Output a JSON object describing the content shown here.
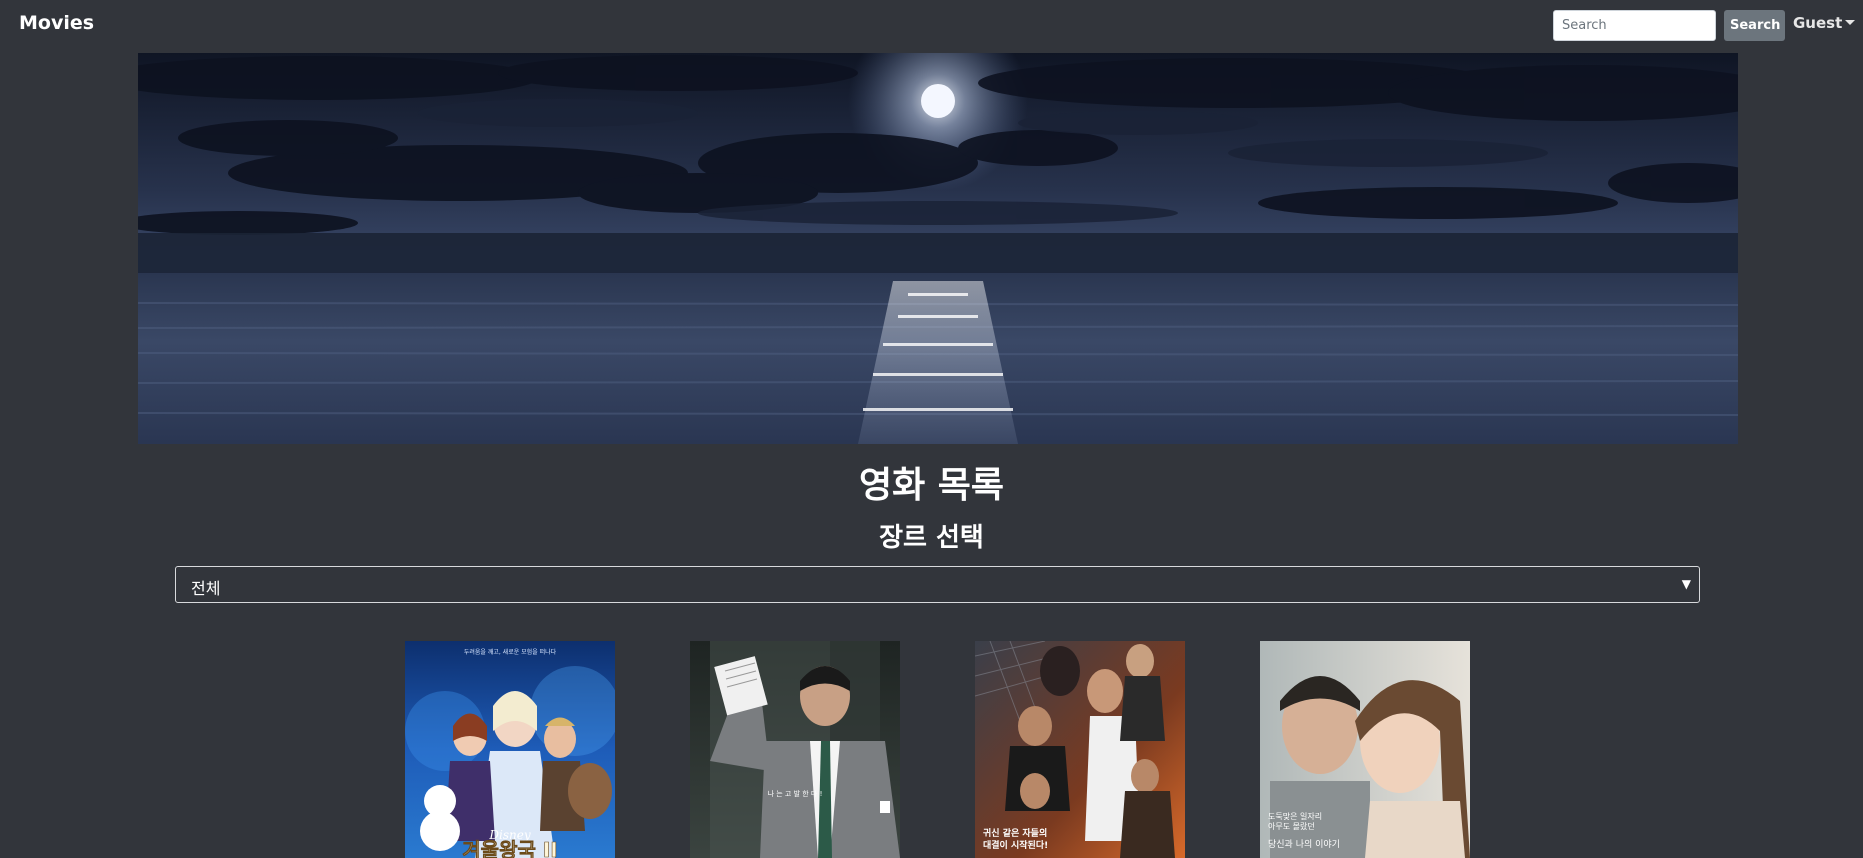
{
  "navbar": {
    "brand": "Movies",
    "search_placeholder": "Search",
    "search_button": "Search",
    "user_label": "Guest"
  },
  "main": {
    "title": "영화 목록",
    "genre_heading": "장르 선택",
    "genre_select": {
      "selected": "전체"
    },
    "movies": [
      {
        "poster_top_text": "두려움을 깨고, 새로운 모험을 떠나다",
        "poster_brand": "Disney",
        "poster_title": "겨울왕국 II"
      },
      {
        "poster_mid_text": "나 는 고 발 한 다 !"
      },
      {
        "poster_tagline_1": "귀신 같은 자들의",
        "poster_tagline_2": "대결이 시작된다!"
      },
      {
        "poster_tagline_1": "도둑맞은 일자리",
        "poster_tagline_2": "아무도 몰랐던",
        "poster_tagline_3": "당신과 나의 이야기"
      }
    ]
  },
  "colors": {
    "background": "#32353b",
    "search_button": "#6c757d"
  }
}
